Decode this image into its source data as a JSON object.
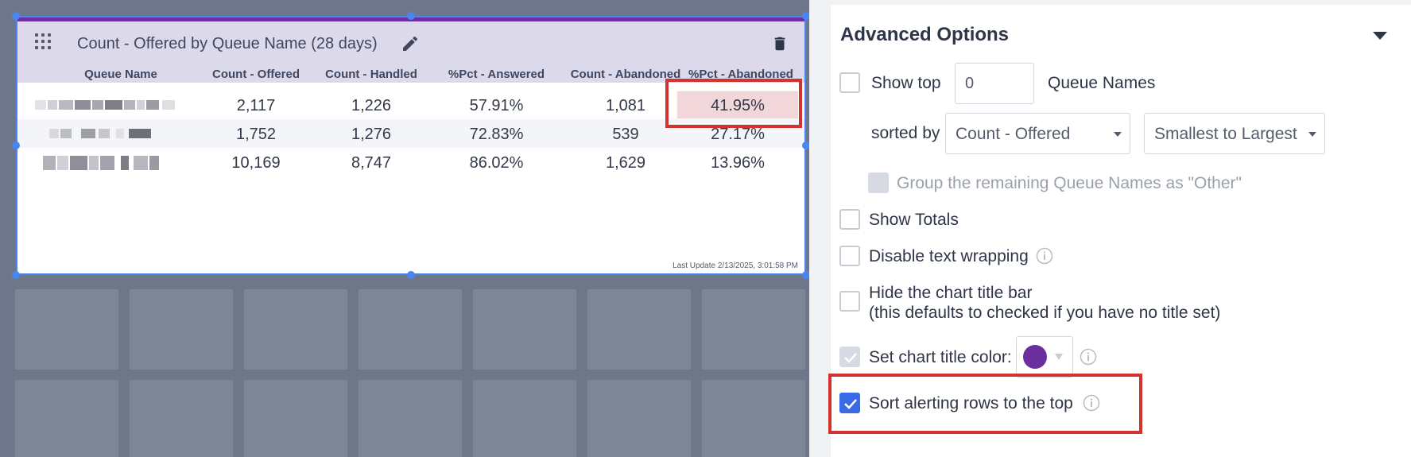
{
  "colors": {
    "accent_purple": "#6b2fa0",
    "selection_blue": "#4a86f0",
    "alert_bg": "#f1d7da",
    "highlight_red": "#d2332f",
    "checkbox_blue": "#3a6ae6"
  },
  "widget": {
    "title": "Count - Offered by Queue Name (28 days)",
    "icons": {
      "drag": "drag-grip-icon",
      "edit": "pencil-icon",
      "delete": "trash-icon"
    },
    "columns": [
      "Queue Name",
      "Count - Offered",
      "Count - Handled",
      "%Pct - Answered",
      "Count - Abandoned",
      "%Pct - Abandoned"
    ],
    "rows": [
      {
        "queue_name": "",
        "offered": "2,117",
        "handled": "1,226",
        "pct_answered": "57.91%",
        "abandoned": "1,081",
        "pct_abandoned": "41.95%",
        "alerting": true
      },
      {
        "queue_name": "",
        "offered": "1,752",
        "handled": "1,276",
        "pct_answered": "72.83%",
        "abandoned": "539",
        "pct_abandoned": "27.17%",
        "alerting": false
      },
      {
        "queue_name": "",
        "offered": "10,169",
        "handled": "8,747",
        "pct_answered": "86.02%",
        "abandoned": "1,629",
        "pct_abandoned": "13.96%",
        "alerting": false
      }
    ],
    "last_update": "Last Update 2/13/2025, 3:01:58 PM"
  },
  "panel": {
    "title": "Advanced Options",
    "show_top": {
      "label": "Show top",
      "value": "0",
      "suffix": "Queue Names",
      "checked": false
    },
    "sorted_by": {
      "label": "sorted by",
      "field": "Count - Offered",
      "order": "Smallest to Largest"
    },
    "group_remaining": {
      "label": "Group the remaining Queue Names as \"Other\"",
      "checked": false,
      "disabled": true
    },
    "show_totals": {
      "label": "Show Totals",
      "checked": false
    },
    "disable_wrap": {
      "label": "Disable text wrapping",
      "checked": false
    },
    "hide_title_bar": {
      "label_line1": "Hide the chart title bar",
      "label_line2": "(this defaults to checked if you have no title set)",
      "checked": false
    },
    "title_color": {
      "label": "Set chart title color:",
      "checked": true,
      "disabled": true,
      "color": "#6b2fa0"
    },
    "sort_alerting": {
      "label": "Sort alerting rows to the top",
      "checked": true
    }
  }
}
